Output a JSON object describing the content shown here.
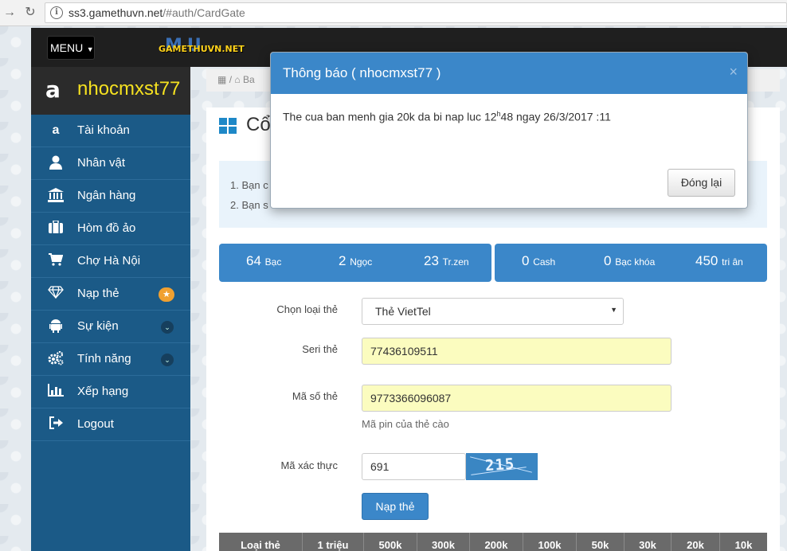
{
  "browser": {
    "url_host": "ss3.gamethuvn.net",
    "url_path": "/#auth/CardGate"
  },
  "topbar": {
    "menu_label": "MENU",
    "logo_mu": "MU",
    "logo_text": "GAMETHUVN.NET"
  },
  "sidebar": {
    "username": "nhocmxst77",
    "items": [
      {
        "label": "Tài khoản",
        "icon": "amazon-icon"
      },
      {
        "label": "Nhân vật",
        "icon": "user-icon"
      },
      {
        "label": "Ngân hàng",
        "icon": "bank-icon"
      },
      {
        "label": "Hòm đồ ảo",
        "icon": "briefcase-icon"
      },
      {
        "label": "Chợ Hà Nội",
        "icon": "cart-icon"
      },
      {
        "label": "Nạp thẻ",
        "icon": "diamond-icon"
      },
      {
        "label": "Sự kiện",
        "icon": "android-icon"
      },
      {
        "label": "Tính năng",
        "icon": "gears-icon"
      },
      {
        "label": "Xếp hạng",
        "icon": "bar-chart-icon"
      },
      {
        "label": "Logout",
        "icon": "sign-out-icon"
      }
    ]
  },
  "breadcrumb": {
    "text": "Ba"
  },
  "panel": {
    "title": "Cổ",
    "notes": [
      "1. Bạn c",
      "2. Bạn s"
    ]
  },
  "stats": [
    {
      "value": "64",
      "unit": "Bạc"
    },
    {
      "value": "2",
      "unit": "Ngọc"
    },
    {
      "value": "23",
      "unit": "Tr.zen"
    },
    {
      "value": "0",
      "unit": "Cash"
    },
    {
      "value": "0",
      "unit": "Bạc khóa"
    },
    {
      "value": "450",
      "unit": "tri ân"
    }
  ],
  "form": {
    "card_type_label": "Chọn loại thẻ",
    "card_type_value": "Thẻ VietTel",
    "serial_label": "Seri thẻ",
    "serial_value": "77436109511",
    "pin_label": "Mã số thẻ",
    "pin_value": "9773366096087",
    "pin_help": "Mã pin của thẻ cào",
    "captcha_label": "Mã xác thực",
    "captcha_value": "691",
    "captcha_image_text": "215",
    "submit_label": "Nạp thẻ"
  },
  "table": {
    "headers": [
      "Loại thẻ",
      "1 triệu",
      "500k",
      "300k",
      "200k",
      "100k",
      "50k",
      "30k",
      "20k",
      "10k"
    ]
  },
  "modal": {
    "title": "Thông báo ( nhocmxst77 )",
    "close_glyph": "×",
    "message_pre": "The cua ban menh gia 20k da bi nap luc 12",
    "message_sup": "h",
    "message_post": "48 ngay 26/3/2017 :11",
    "close_button": "Đóng lại"
  },
  "colors": {
    "accent": "#3b87c9",
    "sidebar": "#1b5a87",
    "username": "#f5e120"
  }
}
